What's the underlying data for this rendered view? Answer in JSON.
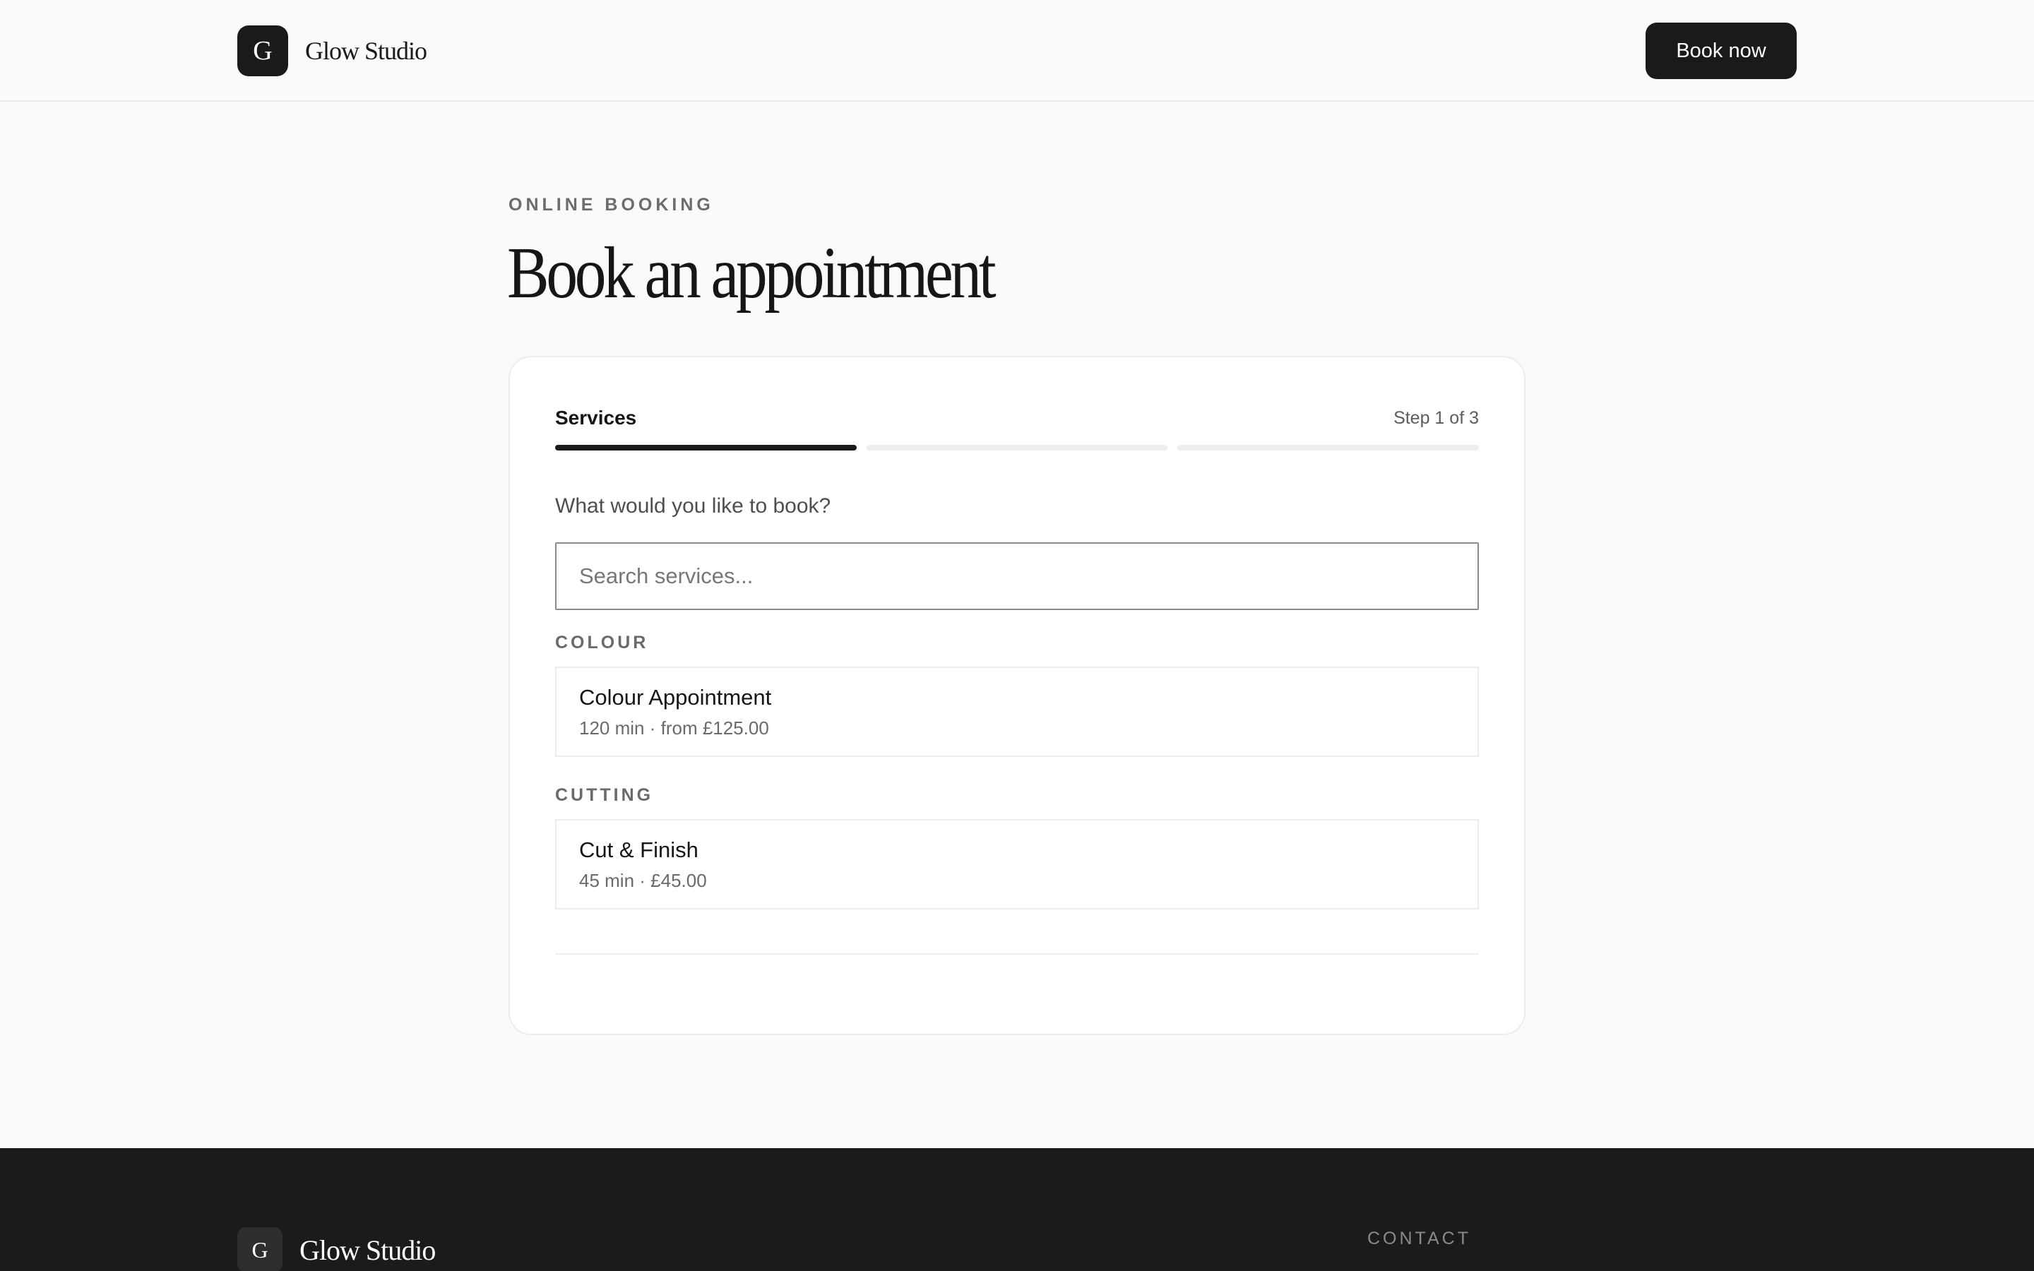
{
  "header": {
    "logo_letter": "G",
    "brand_name": "Glow Studio",
    "cta_label": "Book now"
  },
  "intro": {
    "eyebrow": "ONLINE BOOKING",
    "title": "Book an appointment"
  },
  "booking": {
    "step_title": "Services",
    "step_count": "Step 1 of 3",
    "progress": {
      "current_step": 1,
      "total_steps": 3
    },
    "question": "What would you like to book?",
    "search": {
      "placeholder": "Search services...",
      "value": ""
    },
    "categories": [
      {
        "label": "COLOUR",
        "services": [
          {
            "name": "Colour Appointment",
            "meta": "120 min · from £125.00"
          }
        ]
      },
      {
        "label": "CUTTING",
        "services": [
          {
            "name": "Cut & Finish",
            "meta": "45 min · £45.00"
          }
        ]
      }
    ]
  },
  "footer": {
    "logo_letter": "G",
    "brand_name": "Glow Studio",
    "contact_heading": "CONTACT"
  },
  "colors": {
    "background": "#fafafa",
    "primary_dark": "#1a1a1a",
    "card_border": "#ececec",
    "muted_text": "#6a6a6a"
  }
}
